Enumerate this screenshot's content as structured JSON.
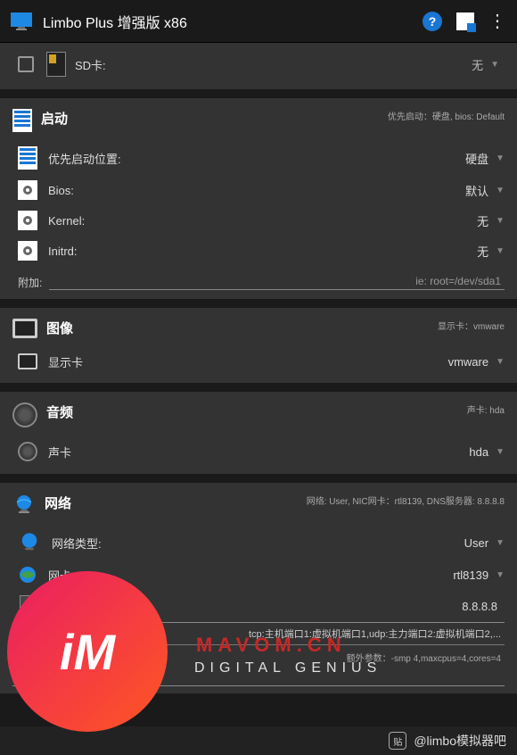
{
  "appbar": {
    "title": "Limbo Plus 增强版 x86"
  },
  "sd": {
    "label": "SD卡:",
    "value": "无"
  },
  "boot": {
    "title": "启动",
    "summary": "优先启动：硬盘, bios: Default",
    "priority": {
      "label": "优先启动位置:",
      "value": "硬盘"
    },
    "bios": {
      "label": "Bios:",
      "value": "默认"
    },
    "kernel": {
      "label": "Kernel:",
      "value": "无"
    },
    "initrd": {
      "label": "Initrd:",
      "value": "无"
    },
    "append": {
      "label": "附加:",
      "placeholder": "ie: root=/dev/sda1"
    }
  },
  "graphics": {
    "title": "图像",
    "summary": "显示卡：vmware",
    "card": {
      "label": "显示卡",
      "value": "vmware"
    }
  },
  "audio": {
    "title": "音频",
    "summary": "声卡: hda",
    "card": {
      "label": "声卡",
      "value": "hda"
    }
  },
  "network": {
    "title": "网络",
    "summary": "网络: User, NIC网卡：rtl8139, DNS服务器: 8.8.8.8",
    "type": {
      "label": "网络类型:",
      "value": "User"
    },
    "nic": {
      "label": "网卡:",
      "value": "rtl8139"
    },
    "dns": {
      "label": "DNS服务器:",
      "value": "8.8.8.8"
    },
    "fwd": "tcp:主机端口1:虚拟机端口1,udp:主力端口2:虚拟机端口2,...",
    "extra_label": "额外参数：-smp 4,maxcpus=4,cores=4",
    "extra_value": "axcpus=4,cores=4"
  },
  "watermark": {
    "brand": "MAVOM.CN",
    "tagline": "DIGITAL GENIUS",
    "logo": "iM"
  },
  "footer": {
    "tag": "贴",
    "text": "@limbo模拟器吧"
  }
}
